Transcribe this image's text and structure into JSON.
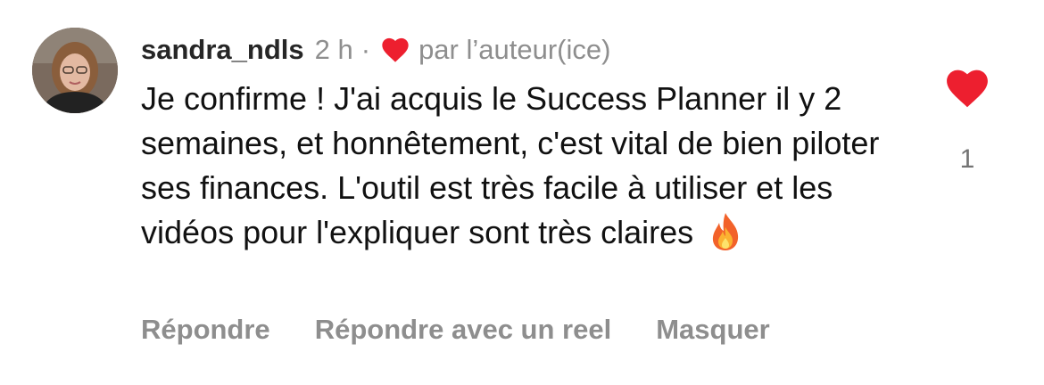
{
  "comment": {
    "avatar_icon": "profile-photo",
    "username": "sandra_ndls",
    "time": "2 h",
    "separator": "·",
    "author_like_icon": "heart-icon",
    "author_like_label": "par l’auteur(ice)",
    "text": "Je confirme ! J'ai acquis le Success Planner il y 2 semaines, et honnêtement, c'est vital de bien piloter ses finances. L'outil est très facile à utiliser et les vidéos pour l'expliquer sont très claires",
    "emoji": "🔥",
    "emoji_icon": "fire-icon",
    "actions": {
      "reply": "Répondre",
      "reply_reel": "Répondre avec un reel",
      "hide": "Masquer"
    },
    "like": {
      "icon": "heart-icon",
      "count": "1",
      "liked": true
    }
  },
  "colors": {
    "heart": "#ed1f2f",
    "secondary_text": "#8e8e8e",
    "primary_text": "#111111",
    "username": "#262626"
  }
}
